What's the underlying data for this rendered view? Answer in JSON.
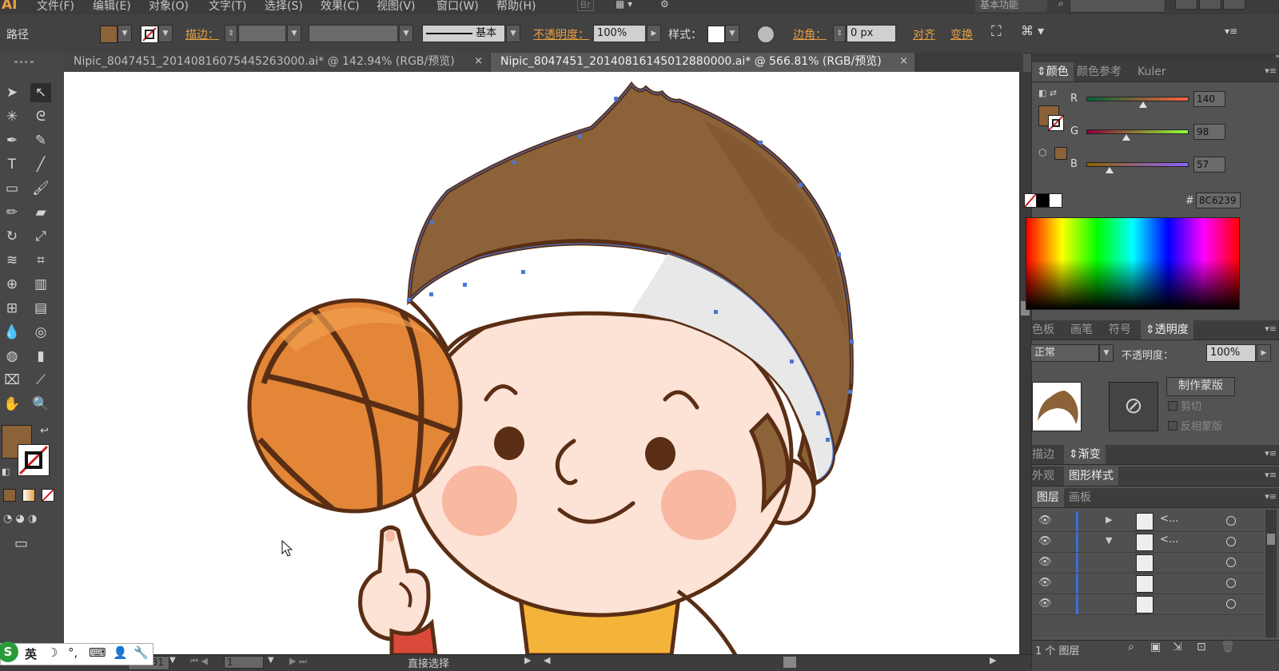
{
  "menubar": {
    "logo": "AI",
    "items": [
      "文件(F)",
      "编辑(E)",
      "对象(O)",
      "文字(T)",
      "选择(S)",
      "效果(C)",
      "视图(V)",
      "窗口(W)",
      "帮助(H)"
    ],
    "bridge": "Br",
    "workspace": "基本功能"
  },
  "control": {
    "selection_type": "路径",
    "fill_color": "#8C6239",
    "stroke_label": "描边：",
    "stroke_profile": "基本",
    "opacity_label": "不透明度：",
    "opacity_value": "100%",
    "style_label": "样式：",
    "corner_label": "边角：",
    "corner_value": "0 px",
    "align_label": "对齐",
    "transform_label": "变换"
  },
  "tabs": [
    {
      "label": "Nipic_8047451_20140816075445263000.ai* @ 142.94% (RGB/预览)",
      "close": "×"
    },
    {
      "label": "Nipic_8047451_20140816145012880000.ai* @ 566.81% (RGB/预览)",
      "close": "×"
    }
  ],
  "tools": [
    "selection-tool",
    "direct-selection-tool",
    "magic-wand-tool",
    "lasso-tool",
    "pen-tool",
    "curvature-tool",
    "type-tool",
    "line-tool",
    "rectangle-tool",
    "paintbrush-tool",
    "pencil-tool",
    "eraser-tool",
    "rotate-tool",
    "scale-tool",
    "warp-tool",
    "free-transform-tool",
    "shape-builder-tool",
    "graph-tool",
    "mesh-tool",
    "gradient-tool",
    "eyedropper-tool",
    "blend-tool",
    "symbol-sprayer-tool",
    "column-graph-tool",
    "artboard-tool",
    "slice-tool",
    "hand-tool",
    "zoom-tool"
  ],
  "colors": {
    "fill": "#8C6239",
    "accent": "#E8A041"
  },
  "color_panel": {
    "tabs": [
      "颜色",
      "颜色参考",
      "Kuler"
    ],
    "r_label": "R",
    "r_value": "140",
    "g_label": "G",
    "g_value": "98",
    "b_label": "B",
    "b_value": "57",
    "hex_label": "#",
    "hex_value": "8C6239"
  },
  "swatch_panel": {
    "tabs": [
      "色板",
      "画笔",
      "符号",
      "透明度"
    ],
    "blend_mode": "正常",
    "opacity_label": "不透明度：",
    "opacity_value": "100%",
    "make_mask": "制作蒙版",
    "clip": "剪切",
    "invert_mask": "反相蒙版"
  },
  "stroke_panel": {
    "tabs": [
      "描边",
      "渐变"
    ]
  },
  "appearance_panel": {
    "tabs": [
      "外观",
      "图形样式"
    ]
  },
  "layers_panel": {
    "tabs": [
      "图层",
      "画板"
    ],
    "rows": [
      {
        "name": "<..."
      },
      {
        "name": "<..."
      },
      {
        "name": ""
      },
      {
        "name": ""
      },
      {
        "name": ""
      }
    ],
    "footer": "1 个 图层"
  },
  "status": {
    "zoom": "566.81",
    "page": "1",
    "tool_name": "直接选择"
  },
  "ime": {
    "label": "英"
  }
}
